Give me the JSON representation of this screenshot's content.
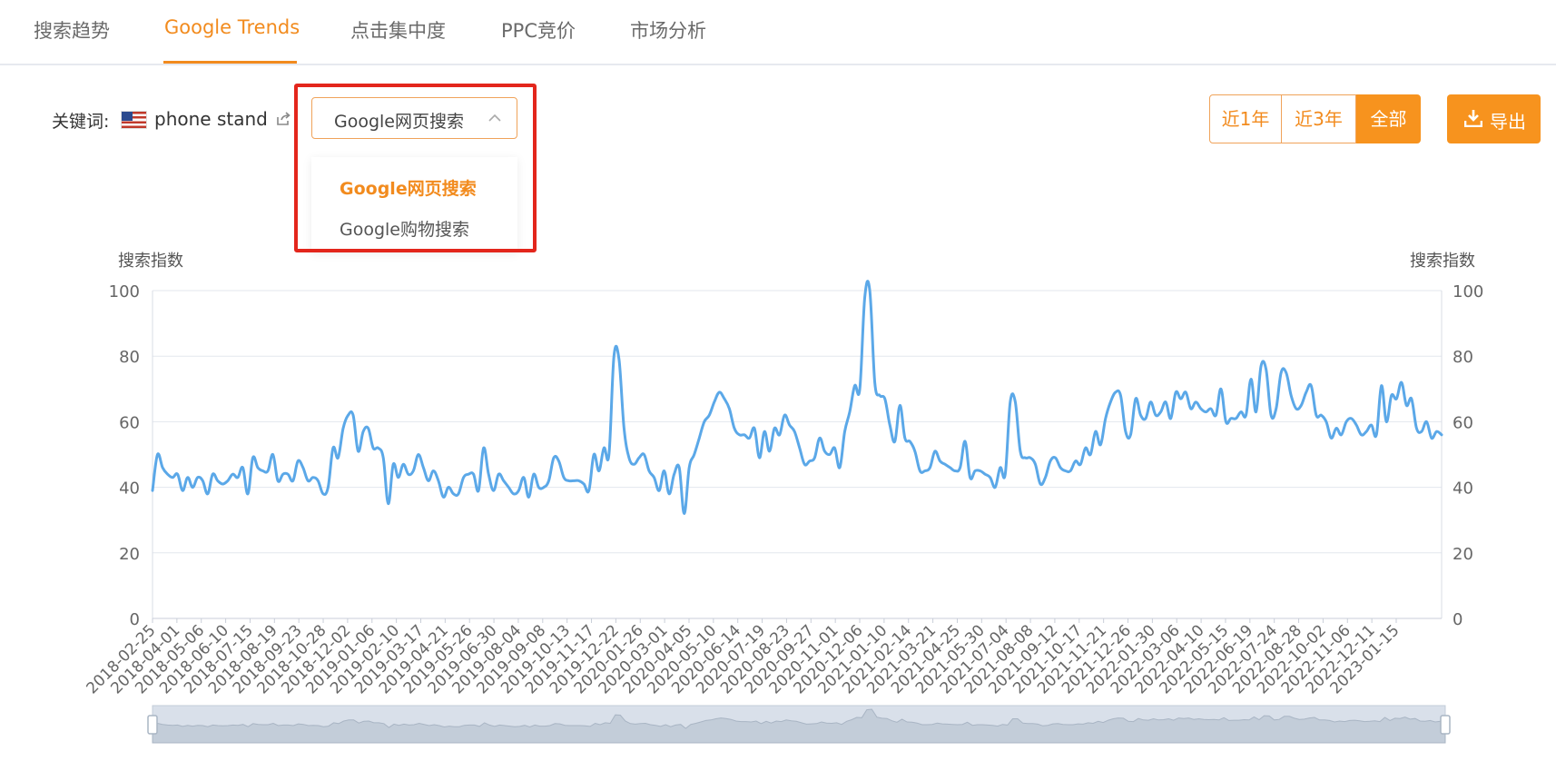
{
  "tabs": [
    {
      "label": "搜索趋势",
      "active": false
    },
    {
      "label": "Google Trends",
      "active": true
    },
    {
      "label": "点击集中度",
      "active": false
    },
    {
      "label": "PPC竞价",
      "active": false
    },
    {
      "label": "市场分析",
      "active": false
    }
  ],
  "keyword": {
    "label": "关键词:",
    "value": "phone stand",
    "country_icon": "us-flag-icon"
  },
  "search_type": {
    "selected": "Google网页搜索",
    "options": [
      "Google网页搜索",
      "Google购物搜索"
    ]
  },
  "range_buttons": [
    {
      "label": "近1年",
      "active": false
    },
    {
      "label": "近3年",
      "active": false
    },
    {
      "label": "全部",
      "active": true
    }
  ],
  "export_label": "导出",
  "colors": {
    "accent": "#f7931e",
    "line": "#5ba8e8",
    "highlight": "#e3261c"
  },
  "chart_data": {
    "type": "line",
    "ylabel_left": "搜索指数",
    "ylabel_right": "搜索指数",
    "ylim": [
      0,
      100
    ],
    "yticks": [
      0,
      20,
      40,
      60,
      80,
      100
    ],
    "x_tick_labels": [
      "2018-02-25",
      "2018-04-01",
      "2018-05-06",
      "2018-06-10",
      "2018-07-15",
      "2018-08-19",
      "2018-09-23",
      "2018-10-28",
      "2018-12-02",
      "2019-01-06",
      "2019-02-10",
      "2019-03-17",
      "2019-04-21",
      "2019-05-26",
      "2019-06-30",
      "2019-08-04",
      "2019-09-08",
      "2019-10-13",
      "2019-11-17",
      "2019-12-22",
      "2020-01-26",
      "2020-03-01",
      "2020-04-05",
      "2020-05-10",
      "2020-06-14",
      "2020-07-19",
      "2020-08-23",
      "2020-09-27",
      "2020-11-01",
      "2020-12-06",
      "2021-01-10",
      "2021-02-14",
      "2021-03-21",
      "2021-04-25",
      "2021-05-30",
      "2021-07-04",
      "2021-08-08",
      "2021-09-12",
      "2021-10-17",
      "2021-11-21",
      "2021-12-26",
      "2022-01-30",
      "2022-03-06",
      "2022-04-10",
      "2022-05-15",
      "2022-06-19",
      "2022-07-24",
      "2022-08-28",
      "2022-10-02",
      "2022-11-06",
      "2022-12-11",
      "2023-01-15"
    ],
    "series": [
      {
        "values": [
          39,
          50,
          46,
          44,
          43,
          44,
          39,
          43,
          40,
          43,
          42,
          38,
          44,
          42,
          41,
          42,
          44,
          43,
          46,
          38,
          49,
          46,
          45,
          45,
          50,
          42,
          44,
          44,
          42,
          48,
          46,
          42,
          43,
          42,
          38,
          40,
          52,
          49,
          58,
          62,
          62,
          51,
          57,
          58,
          52,
          52,
          49,
          35,
          47,
          43,
          47,
          44,
          45,
          50,
          46,
          42,
          45,
          42,
          37,
          40,
          38,
          38,
          43,
          44,
          44,
          39,
          52,
          44,
          39,
          44,
          42,
          40,
          38,
          39,
          43,
          37,
          44,
          40,
          40,
          42,
          49,
          48,
          43,
          42,
          42,
          42,
          41,
          39,
          50,
          45,
          52,
          50,
          80,
          79,
          58,
          49,
          47,
          49,
          50,
          45,
          43,
          39,
          45,
          38,
          44,
          46,
          32,
          46,
          50,
          55,
          60,
          62,
          66,
          69,
          67,
          64,
          58,
          56,
          56,
          55,
          58,
          49,
          57,
          51,
          58,
          56,
          62,
          59,
          57,
          52,
          47,
          48,
          49,
          55,
          51,
          50,
          52,
          46,
          57,
          63,
          71,
          70,
          98,
          100,
          72,
          68,
          67,
          59,
          54,
          65,
          55,
          54,
          51,
          45,
          45,
          46,
          51,
          48,
          47,
          46,
          45,
          46,
          54,
          43,
          45,
          45,
          44,
          43,
          40,
          46,
          44,
          66,
          66,
          51,
          49,
          49,
          47,
          41,
          43,
          48,
          49,
          46,
          45,
          45,
          48,
          47,
          52,
          50,
          57,
          53,
          61,
          66,
          69,
          68,
          57,
          56,
          67,
          62,
          61,
          66,
          62,
          63,
          66,
          61,
          69,
          67,
          69,
          64,
          66,
          64,
          63,
          64,
          62,
          70,
          60,
          61,
          61,
          63,
          62,
          73,
          63,
          77,
          76,
          62,
          64,
          75,
          75,
          68,
          64,
          65,
          69,
          71,
          62,
          62,
          60,
          55,
          58,
          56,
          60,
          61,
          59,
          56,
          57,
          59,
          56,
          71,
          60,
          68,
          67,
          72,
          65,
          67,
          58,
          57,
          60,
          55,
          57,
          56
        ]
      }
    ]
  }
}
